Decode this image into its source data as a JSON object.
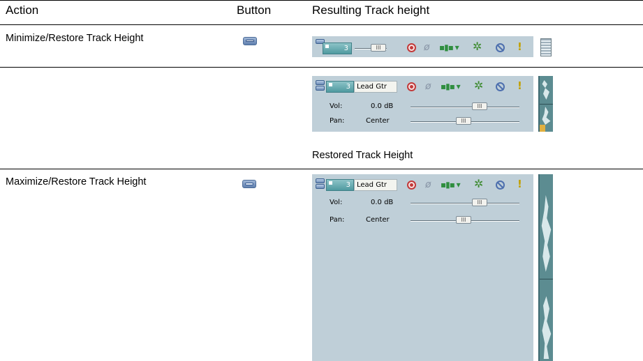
{
  "table": {
    "headers": {
      "action": "Action",
      "button": "Button",
      "result": "Resulting Track height"
    },
    "rows": [
      {
        "action": "Minimize/Restore Track Height",
        "button_icon": "minimize-restore-icon"
      },
      {
        "caption": "Restored Track Height"
      },
      {
        "action": "Maximize/Restore Track Height",
        "button_icon": "maximize-restore-icon"
      }
    ]
  },
  "track": {
    "number": "3",
    "name": "Lead Gtr",
    "vol_label": "Vol:",
    "vol_value": "0.0 dB",
    "pan_label": "Pan:",
    "pan_value": "Center",
    "icons": [
      "record-arm-icon",
      "invert-phase-icon",
      "fx-chain-icon",
      "automation-gear-icon",
      "mute-icon",
      "solo-icon"
    ]
  },
  "colors": {
    "panel": "#bfcfd8",
    "track_number": "#4f9aa0",
    "record": "#c23a3a",
    "waveform": "#5c8c91"
  }
}
